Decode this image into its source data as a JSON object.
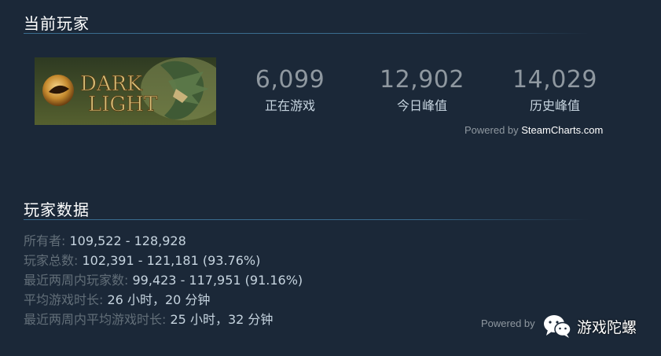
{
  "current_players": {
    "title": "当前玩家",
    "game_logo_text": [
      "DARK",
      "LIGHT"
    ],
    "stats": [
      {
        "value": "6,099",
        "label": "正在游戏"
      },
      {
        "value": "12,902",
        "label": "今日峰值"
      },
      {
        "value": "14,029",
        "label": "历史峰值"
      }
    ],
    "powered_prefix": "Powered by ",
    "powered_source": "SteamCharts.com"
  },
  "player_data": {
    "title": "玩家数据",
    "rows": [
      {
        "key": "所有者:",
        "value": " 109,522 - 128,928"
      },
      {
        "key": "玩家总数:",
        "value": " 102,391 - 121,181 (93.76%)"
      },
      {
        "key": "最近两周内玩家数:",
        "value": " 99,423 - 117,951 (91.16%)"
      },
      {
        "key": "平均游戏时长:",
        "value": " 26 小时，20 分钟"
      },
      {
        "key": "最近两周内平均游戏时长:",
        "value": " 25 小时，32 分钟"
      }
    ],
    "powered_prefix": "Powered by "
  },
  "watermark": {
    "text": "游戏陀螺",
    "icon": "wechat-icon"
  },
  "colors": {
    "background": "#1b2838",
    "rule": "#3a6c8f",
    "number": "#8f98a0",
    "dim_label": "#626e78"
  }
}
